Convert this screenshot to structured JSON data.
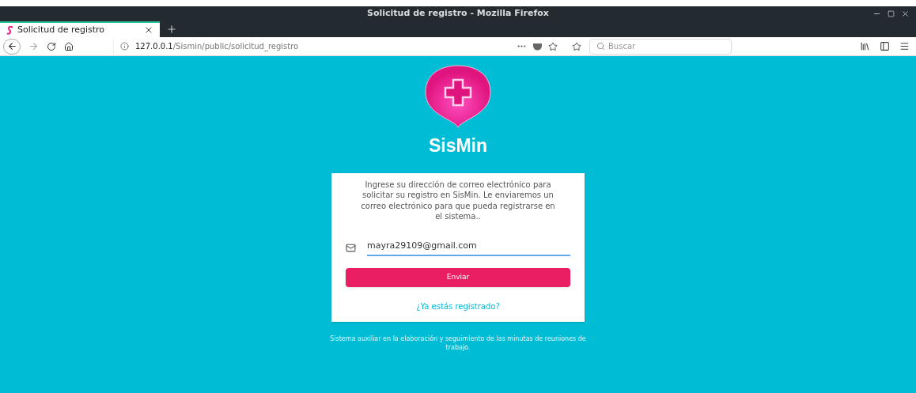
{
  "window": {
    "title": "Solicitud de registro - Mozilla Firefox"
  },
  "tabs": [
    {
      "label": "Solicitud de registro",
      "selected": true
    }
  ],
  "address_bar": {
    "host": "127.0.0.1",
    "path": "/Sismin/public/solicitud_registro"
  },
  "search": {
    "placeholder": "Buscar"
  },
  "app": {
    "name": "SisMin"
  },
  "card": {
    "intro": "Ingrese su dirección de correo electrónico para solicitar su registro en SisMin. Le enviaremos un correo electrónico para que pueda registrarse en el sistema..",
    "email": {
      "value": "mayra29109@gmail.com"
    },
    "submit": "Enviar",
    "login_link": "¿Ya estás registrado?"
  },
  "footer": "Sistema auxiliar en la elaboración y seguimiento de las minutas de reuniones de trabajo."
}
